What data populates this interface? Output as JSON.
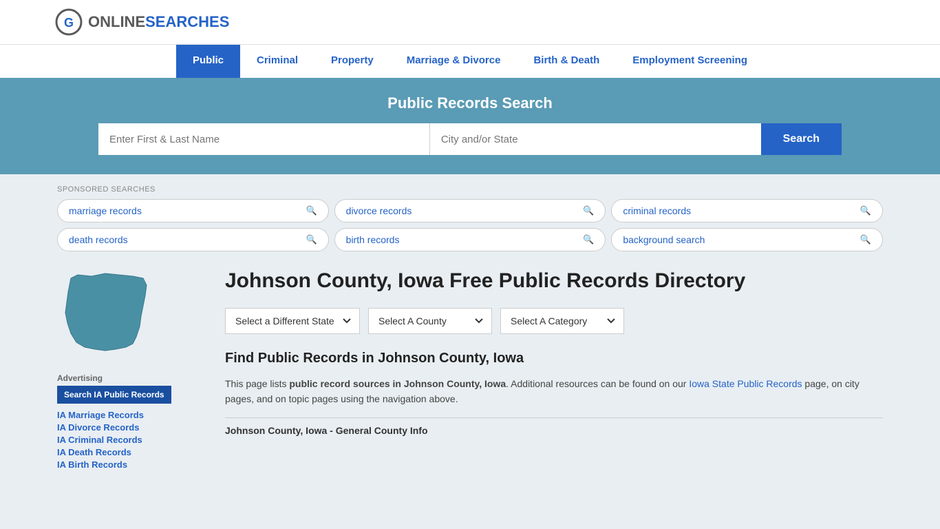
{
  "header": {
    "logo_online": "ONLINE",
    "logo_searches": "SEARCHES"
  },
  "nav": {
    "items": [
      {
        "label": "Public",
        "active": true
      },
      {
        "label": "Criminal",
        "active": false
      },
      {
        "label": "Property",
        "active": false
      },
      {
        "label": "Marriage & Divorce",
        "active": false
      },
      {
        "label": "Birth & Death",
        "active": false
      },
      {
        "label": "Employment Screening",
        "active": false
      }
    ]
  },
  "hero": {
    "title": "Public Records Search",
    "name_placeholder": "Enter First & Last Name",
    "location_placeholder": "City and/or State",
    "search_button": "Search"
  },
  "sponsored": {
    "label": "SPONSORED SEARCHES",
    "pills": [
      {
        "text": "marriage records"
      },
      {
        "text": "divorce records"
      },
      {
        "text": "criminal records"
      },
      {
        "text": "death records"
      },
      {
        "text": "birth records"
      },
      {
        "text": "background search"
      }
    ]
  },
  "page": {
    "title": "Johnson County, Iowa Free Public Records Directory",
    "dropdowns": {
      "state": "Select a Different State",
      "county": "Select A County",
      "category": "Select A Category"
    },
    "find_heading": "Find Public Records in Johnson County, Iowa",
    "description_start": "This page lists ",
    "description_bold": "public record sources in Johnson County, Iowa",
    "description_mid": ". Additional resources can be found on our ",
    "description_link": "Iowa State Public Records",
    "description_end": " page, on city pages, and on topic pages using the navigation above.",
    "general_info": "Johnson County, Iowa - General County Info"
  },
  "sidebar": {
    "advertising_label": "Advertising",
    "cta_label": "Search IA Public Records",
    "links": [
      {
        "label": "IA Marriage Records"
      },
      {
        "label": "IA Divorce Records"
      },
      {
        "label": "IA Criminal Records"
      },
      {
        "label": "IA Death Records"
      },
      {
        "label": "IA Birth Records"
      }
    ]
  }
}
